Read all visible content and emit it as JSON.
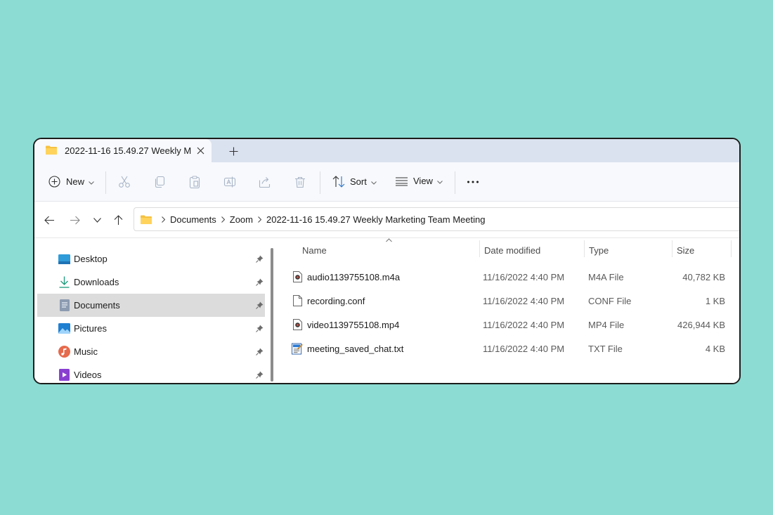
{
  "tab": {
    "title": "2022-11-16 15.49.27 Weekly M"
  },
  "toolbar": {
    "new_label": "New",
    "sort_label": "Sort",
    "view_label": "View"
  },
  "breadcrumb": [
    "Documents",
    "Zoom",
    "2022-11-16 15.49.27 Weekly Marketing Team Meeting"
  ],
  "sidebar": {
    "items": [
      {
        "label": "Desktop",
        "icon": "desktop-icon",
        "selected": false
      },
      {
        "label": "Downloads",
        "icon": "download-icon",
        "selected": false
      },
      {
        "label": "Documents",
        "icon": "documents-icon",
        "selected": true
      },
      {
        "label": "Pictures",
        "icon": "pictures-icon",
        "selected": false
      },
      {
        "label": "Music",
        "icon": "music-icon",
        "selected": false
      },
      {
        "label": "Videos",
        "icon": "videos-icon",
        "selected": false
      }
    ]
  },
  "columns": {
    "name": "Name",
    "date": "Date modified",
    "type": "Type",
    "size": "Size"
  },
  "files": [
    {
      "name": "audio1139755108.m4a",
      "date": "11/16/2022 4:40 PM",
      "type": "M4A File",
      "size": "40,782 KB",
      "icon": "media-file-icon"
    },
    {
      "name": "recording.conf",
      "date": "11/16/2022 4:40 PM",
      "type": "CONF File",
      "size": "1 KB",
      "icon": "blank-file-icon"
    },
    {
      "name": "video1139755108.mp4",
      "date": "11/16/2022 4:40 PM",
      "type": "MP4 File",
      "size": "426,944 KB",
      "icon": "media-file-icon"
    },
    {
      "name": "meeting_saved_chat.txt",
      "date": "11/16/2022 4:40 PM",
      "type": "TXT File",
      "size": "4 KB",
      "icon": "text-file-icon"
    }
  ],
  "colors": {
    "background": "#8cdcd3",
    "folder": "#f5c242",
    "tabbar": "#dbe2ef",
    "selected": "#dcdcdc"
  }
}
